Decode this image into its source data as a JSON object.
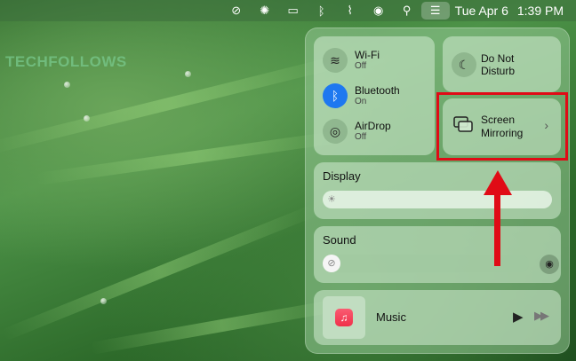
{
  "menubar": {
    "icons": [
      "no-sound-icon",
      "gear-icon",
      "display-icon",
      "bluetooth-icon",
      "wifi-off-icon",
      "user-icon",
      "search-icon",
      "control-center-icon"
    ],
    "date": "Tue Apr 6",
    "time": "1:39 PM"
  },
  "watermark": "TECHFOLLOWS",
  "control_center": {
    "wifi": {
      "label": "Wi-Fi",
      "status": "Off"
    },
    "bluetooth": {
      "label": "Bluetooth",
      "status": "On"
    },
    "airdrop": {
      "label": "AirDrop",
      "status": "Off"
    },
    "dnd": {
      "line1": "Do Not",
      "line2": "Disturb"
    },
    "screen_mirroring": {
      "line1": "Screen",
      "line2": "Mirroring"
    },
    "display": {
      "title": "Display"
    },
    "sound": {
      "title": "Sound"
    },
    "music": {
      "label": "Music"
    }
  },
  "colors": {
    "annotation": "#e00b16",
    "bluetooth": "#1e78f0"
  }
}
